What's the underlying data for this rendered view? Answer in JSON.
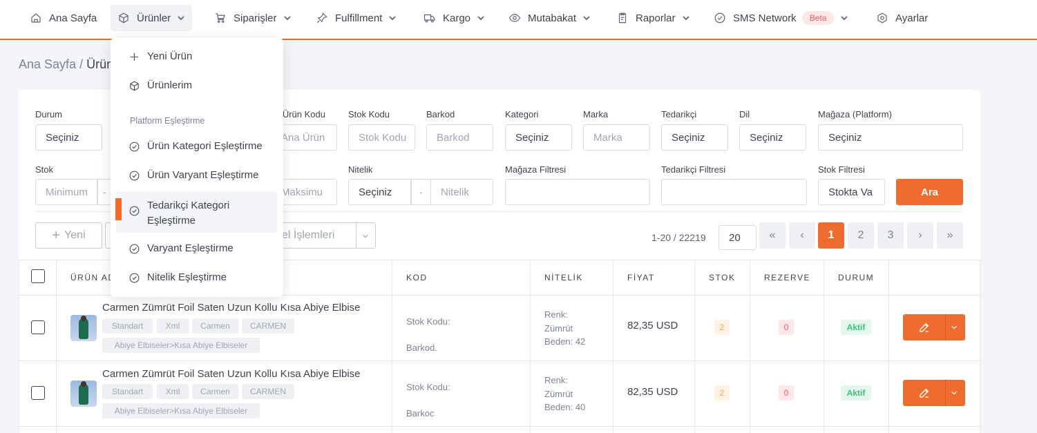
{
  "nav": {
    "items": [
      {
        "label": "Ana Sayfa",
        "icon": "home-icon"
      },
      {
        "label": "Ürünler",
        "icon": "box-icon"
      },
      {
        "label": "Siparişler",
        "icon": "cart-icon"
      },
      {
        "label": "Fulfillment",
        "icon": "pin-icon"
      },
      {
        "label": "Kargo",
        "icon": "truck-icon"
      },
      {
        "label": "Mutabakat",
        "icon": "eye-icon"
      },
      {
        "label": "Raporlar",
        "icon": "report-icon"
      },
      {
        "label": "SMS Network",
        "icon": "check-circle-icon",
        "badge": "Beta"
      },
      {
        "label": "Ayarlar",
        "icon": "settings-hex-icon"
      }
    ]
  },
  "breadcrumb": {
    "home": "Ana Sayfa",
    "separator": "/",
    "current": "Ürün"
  },
  "dropdown": {
    "new_product": "Yeni Ürün",
    "my_products": "Ürünlerim",
    "section_title": "Platform Eşleştirme",
    "items": [
      "Ürün Kategori Eşleştirme",
      "Ürün Varyant Eşleştirme",
      "Tedarikçi Kategori Eşleştirme",
      "Varyant Eşleştirme",
      "Nitelik Eşleştirme"
    ]
  },
  "filters": {
    "durum": {
      "label": "Durum",
      "value": "Seçiniz"
    },
    "ana_urun_kodu": {
      "label": "a Ürün Kodu",
      "placeholder": "Ana Ürün"
    },
    "stok_kodu": {
      "label": "Stok Kodu",
      "placeholder": "Stok Kodu"
    },
    "barkod": {
      "label": "Barkod",
      "placeholder": "Barkod"
    },
    "kategori": {
      "label": "Kategori",
      "value": "Seçiniz"
    },
    "marka": {
      "label": "Marka",
      "placeholder": "Marka"
    },
    "tedarikci": {
      "label": "Tedarikçi",
      "value": "Seçiniz"
    },
    "dil": {
      "label": "Dil",
      "value": "Seçiniz"
    },
    "magaza": {
      "label": "Mağaza (Platform)",
      "value": "Seçiniz"
    },
    "stok": {
      "label": "Stok",
      "min_placeholder": "Minimum",
      "sep": "-",
      "max_placeholder": "Maksimu"
    },
    "nitelik": {
      "label": "Nitelik",
      "value": "Seçiniz",
      "sep": "-",
      "placeholder": "Nitelik"
    },
    "magaza_filtresi": {
      "label": "Mağaza Filtresi"
    },
    "tedarikci_filtresi": {
      "label": "Tedarikçi Filtresi"
    },
    "stok_filtresi": {
      "label": "Stok Filtresi",
      "value": "Stokta Va"
    },
    "search_button": "Ara"
  },
  "toolbar": {
    "new_label": "Yeni",
    "bulk_label": "cel İşlemleri"
  },
  "pagination": {
    "info": "1-20 / 22219",
    "page_size": "20",
    "first": "«",
    "prev": "‹",
    "pages": [
      "1",
      "2",
      "3"
    ],
    "active": "1",
    "next": "›",
    "last": "»"
  },
  "table": {
    "headers": [
      "ÜRÜN AD",
      "KOD",
      "NİTELİK",
      "FİYAT",
      "STOK",
      "REZERVE",
      "DURUM"
    ],
    "rows": [
      {
        "name": "Carmen Zümrüt Foil Saten Uzun Kollu Kısa Abiye Elbise",
        "tags": [
          "Standart",
          "Xml",
          "Carmen",
          "CARMEN"
        ],
        "category": "Abiye Elbiseler>Kısa Abiye Elbiseler",
        "kod_stok": "Stok Kodu:",
        "kod_barkod": "Barkod.",
        "nitelik": [
          "Renk:",
          "Zümrüt",
          "Beden: 42"
        ],
        "price": "82,35 USD",
        "stok": "2",
        "rezerve": "0",
        "durum": "Aktif"
      },
      {
        "name": "Carmen Zümrüt Foil Saten Uzun Kollu Kısa Abiye Elbise",
        "tags": [
          "Standart",
          "Xml",
          "Carmen",
          "CARMEN"
        ],
        "category": "Abiye Elbiseler>Kısa Abiye Elbiseler",
        "kod_stok": "Stok Kodu:",
        "kod_barkod": "Barkoc",
        "nitelik": [
          "Renk:",
          "Zümrüt",
          "Beden: 40"
        ],
        "price": "82,35 USD",
        "stok": "2",
        "rezerve": "0",
        "durum": "Aktif"
      }
    ]
  },
  "colors": {
    "accent": "#ef6c2f",
    "border": "#d9dbe2",
    "text": "#3f4254"
  }
}
